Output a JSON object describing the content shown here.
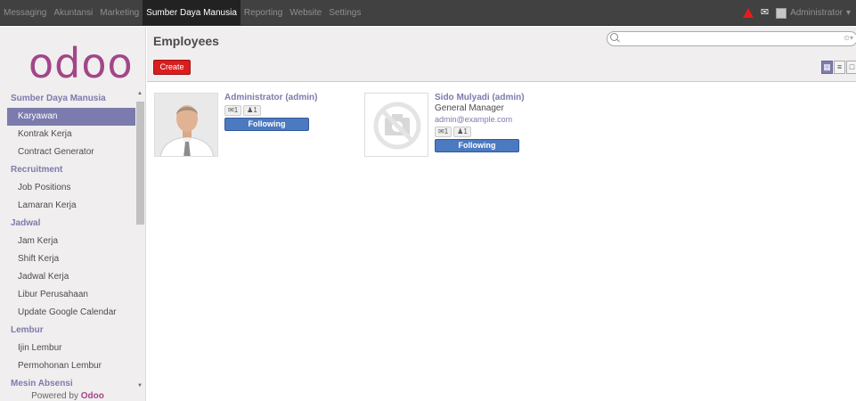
{
  "topbar": {
    "menu": [
      {
        "label": "Messaging",
        "active": false
      },
      {
        "label": "Akuntansi",
        "active": false
      },
      {
        "label": "Marketing",
        "active": false
      },
      {
        "label": "Sumber Daya Manusia",
        "active": true
      },
      {
        "label": "Reporting",
        "active": false
      },
      {
        "label": "Website",
        "active": false
      },
      {
        "label": "Settings",
        "active": false
      }
    ],
    "user_label": "Administrator",
    "alert_color": "#e51c1c"
  },
  "sidebar": {
    "logo": "odoo",
    "logo_color": "#a24689",
    "sections": [
      {
        "title": "Sumber Daya Manusia",
        "items": [
          "Karyawan",
          "Kontrak Kerja",
          "Contract Generator"
        ]
      },
      {
        "title": "Recruitment",
        "items": [
          "Job Positions",
          "Lamaran Kerja"
        ]
      },
      {
        "title": "Jadwal",
        "items": [
          "Jam Kerja",
          "Shift Kerja",
          "Jadwal Kerja",
          "Libur Perusahaan",
          "Update Google Calendar"
        ]
      },
      {
        "title": "Lembur",
        "items": [
          "Ijin Lembur",
          "Permohonan Lembur"
        ]
      },
      {
        "title": "Mesin Absensi",
        "items": []
      }
    ],
    "active_item": "Karyawan",
    "powered_prefix": "Powered by",
    "powered_brand": "Odoo"
  },
  "header": {
    "title": "Employees",
    "create_label": "Create",
    "search_value": ""
  },
  "employees": [
    {
      "name": "Administrator (admin)",
      "job_title": "",
      "email": "",
      "badge_messages": "1",
      "badge_followers": "1",
      "follow_label": "Following",
      "photo": "person-photo"
    },
    {
      "name": "Sido Mulyadi (admin)",
      "job_title": "General Manager",
      "email": "admin@example.com",
      "badge_messages": "1",
      "badge_followers": "1",
      "follow_label": "Following",
      "photo": "no-image-placeholder"
    }
  ],
  "colors": {
    "accent": "#7c7bad",
    "create": "#d81e1e",
    "following": "#4b7ac0"
  }
}
